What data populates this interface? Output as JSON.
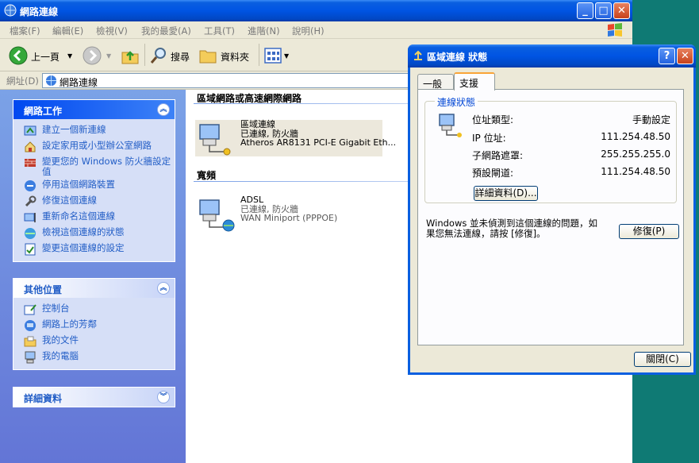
{
  "window": {
    "title": "網路連線"
  },
  "menu": [
    "檔案(F)",
    "編輯(E)",
    "檢視(V)",
    "我的最愛(A)",
    "工具(T)",
    "進階(N)",
    "說明(H)"
  ],
  "toolbar": {
    "back": "上一頁",
    "search": "搜尋",
    "folders": "資料夾"
  },
  "address": {
    "label": "網址(D)",
    "value": "網路連線"
  },
  "left": {
    "tasks": {
      "title": "網路工作",
      "items": [
        "建立一個新連線",
        "設定家用或小型辦公室網路",
        "變更您的 Windows 防火牆設定值",
        "停用這個網路裝置",
        "修復這個連線",
        "重新命名這個連線",
        "檢視這個連線的狀態",
        "變更這個連線的設定"
      ]
    },
    "places": {
      "title": "其他位置",
      "items": [
        "控制台",
        "網路上的芳鄰",
        "我的文件",
        "我的電腦"
      ]
    },
    "details": {
      "title": "詳細資料"
    }
  },
  "content": {
    "group_lan": "區域網路或高速網際網路",
    "group_broadband": "寬頻",
    "lan": {
      "name": "區域連線",
      "status": "已連線, 防火牆",
      "device": "Atheros AR8131 PCI-E Gigabit Eth..."
    },
    "adsl": {
      "name": "ADSL",
      "status": "已連線, 防火牆",
      "device": "WAN Miniport (PPPOE)"
    }
  },
  "dialog": {
    "title": "區域連線 狀態",
    "tabs": [
      "一般",
      "支援"
    ],
    "section": "連線狀態",
    "rows": [
      {
        "key": "位址類型:",
        "value": "手動設定"
      },
      {
        "key": "IP 位址:",
        "value": "111.254.48.50"
      },
      {
        "key": "子網路遮罩:",
        "value": "255.255.255.0"
      },
      {
        "key": "預設閘道:",
        "value": "111.254.48.50"
      }
    ],
    "details_btn": "詳細資料(D)...",
    "message": "Windows 並未偵測到這個連線的問題，如果您無法連線，請按 [修復]。",
    "repair_btn": "修復(P)",
    "close_btn": "關閉(C)"
  }
}
